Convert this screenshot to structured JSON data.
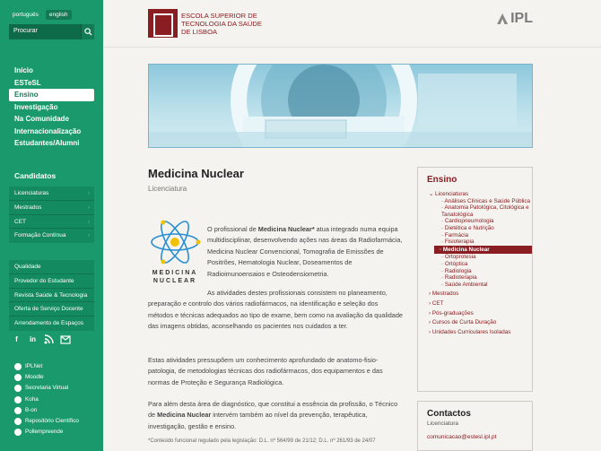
{
  "lang": {
    "pt": "português",
    "en": "english"
  },
  "search": {
    "placeholder": "Procurar"
  },
  "mainnav": [
    "Início",
    "ESTeSL",
    "Ensino",
    "Investigação",
    "Na Comunidade",
    "Internacionalização",
    "Estudantes/Alumni"
  ],
  "candidatos": {
    "title": "Candidatos",
    "items": [
      "Licenciaturas",
      "Mestrados",
      "CET",
      "Formação Contínua"
    ]
  },
  "links": [
    "Qualidade",
    "Provedor do Estudante",
    "Revista Saúde & Tecnologia",
    "Oferta de Serviço Docente",
    "Arrendamento de Espaços"
  ],
  "social": [
    "facebook-icon",
    "linkedin-icon",
    "rss-icon",
    "newsletter-icon"
  ],
  "services": [
    "IPLNet",
    "Moodle",
    "Secretaria Virtual",
    "Koha",
    "B-on",
    "Repositório Científico",
    "Pollempreende"
  ],
  "header": {
    "logo_line1": "Escola Superior de",
    "logo_line2": "Tecnologia da Saúde",
    "logo_line3": "de Lisboa",
    "ipl": "IPL"
  },
  "page": {
    "title": "Medicina Nuclear",
    "subtitle": "Licenciatura",
    "logo_text1": "MEDICINA",
    "logo_text2": "NUCLEAR",
    "p1_a": "O profissional de ",
    "p1_b": "Medicina Nuclear*",
    "p1_c": " atua integrado numa equipa multidisciplinar, desenvolvendo ações nas áreas da Radiofarmácia, Medicina Nuclear Convencional, Tomografia de Emissões de Positrões, Hematologia Nuclear, Doseamentos de Radioimunoensaios e Osteodensiometria.",
    "p2": "As atividades destes profissionais consistem no planeamento, preparação e controlo dos vários radiofármacos, na identificação e seleção dos métodos e técnicas adequados ao tipo de exame, bem como na avaliação da qualidade das imagens obtidas, aconselhando os pacientes nos cuidados a ter.",
    "p3": "Estas atividades pressupõem um conhecimento aprofundado de anatomo-fisio-patologia, de metodologias técnicas dos radiofármacos, dos equipamentos e das normas de Proteção e Segurança Radiológica.",
    "p4_a": "Para além desta área de diagnóstico, que constitui a essência da profissão, o Técnico de ",
    "p4_b": "Medicina Nuclear",
    "p4_c": " intervém também ao nível da prevenção, terapêutica, investigação, gestão e ensino.",
    "note": "*Conteúdo funcional regulado pela legislação: D.L. nº 564/99 de 21/12; D.L. nº 261/93 de 24/07"
  },
  "ensino": {
    "title": "Ensino",
    "licenciaturas": "Licenciaturas",
    "items": [
      "Análises Clínicas e Saúde Pública",
      "Anatomia Patológica, Citológica e Tanatológica",
      "Cardiopneumologia",
      "Dietética e Nutrição",
      "Farmácia",
      "Fisioterapia",
      "Medicina Nuclear",
      "Ortoprotesia",
      "Ortóptica",
      "Radiologia",
      "Radioterapia",
      "Saúde Ambiental"
    ],
    "others": [
      "Mestrados",
      "CET",
      "Pós-graduações",
      "Cursos de Curta Duração",
      "Unidades Curriculares Isoladas"
    ]
  },
  "contactos": {
    "title": "Contactos",
    "subtitle": "Licenciatura",
    "email": "comunicacao@estesl.ipl.pt"
  }
}
